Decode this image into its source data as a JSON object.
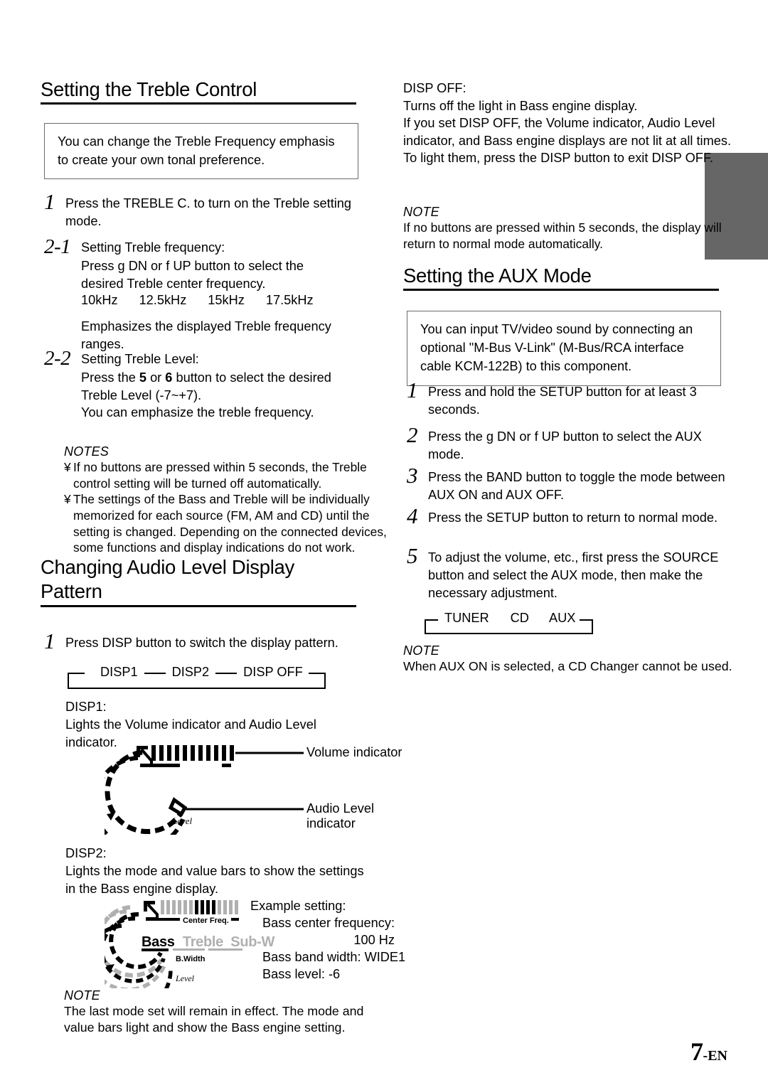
{
  "page": {
    "number": "7",
    "suffix": "-EN"
  },
  "left_column": {
    "treble": {
      "heading": "Setting the Treble Control",
      "intro": "You can change the Treble Frequency emphasis to create your own tonal preference.",
      "step1": {
        "num": "1",
        "text": "Press the TREBLE C. to turn on the Treble setting mode."
      },
      "step2_1": {
        "num": "2-1",
        "title": "Setting  Treble frequency:",
        "line1": "Press g        DN or f        UP button to select the",
        "line2": "desired Treble center frequency.",
        "frequencies": [
          "10kHz",
          "12.5kHz",
          "15kHz",
          "17.5kHz"
        ],
        "after": "Emphasizes the displayed Treble frequency ranges."
      },
      "step2_2": {
        "num": "2-2",
        "title": "Setting Treble Level:",
        "line1_a": "Press the ",
        "line1_b": "5",
        "line1_c": " or ",
        "line1_d": "6",
        "line1_e": " button to select the desired",
        "line2": "Treble Level (-7~+7).",
        "line3": "You can emphasize the treble frequency."
      },
      "notes_heading": "NOTES",
      "notes": [
        {
          "bullet": "¥",
          "text": "If no buttons are pressed within 5 seconds, the Treble control setting will be turned off automatically."
        },
        {
          "bullet": "¥",
          "text": "The settings of the Bass and Treble will be individually memorized for each source (FM, AM and CD) until the setting is changed. Depending on the connected devices, some functions and display indications do not work."
        }
      ]
    },
    "display_pattern": {
      "heading_line1": "Changing Audio Level Display",
      "heading_line2": "Pattern",
      "step1": {
        "num": "1",
        "text": "Press DISP button to switch the display pattern."
      },
      "cycle": [
        "DISP1",
        "DISP2",
        "DISP OFF"
      ],
      "disp1": {
        "label": "DISP1:",
        "text": "Lights the Volume indicator and Audio Level indicator.",
        "callout_volume": "Volume indicator",
        "callout_audio_level": "Audio Level indicator",
        "arc_label_level": "Level"
      },
      "disp2": {
        "label": "DISP2:",
        "text": "Lights the mode and value bars to show the settings in the Bass engine display.",
        "arc_label_center_freq": "Center Freq.",
        "arc_label_bwidth": "B.Width",
        "arc_label_level": "Level",
        "mode_bass": "Bass",
        "mode_treble": "Treble",
        "mode_subw": "Sub-W",
        "example_title": "Example setting:",
        "example_line1": "Bass center frequency:",
        "example_line2": "100 Hz",
        "example_line3": "Bass band width: WIDE1",
        "example_line4": "Bass level: -6"
      },
      "note_heading": "NOTE",
      "note_text": "The last mode set will remain in effect. The mode and value bars light and show the Bass engine setting."
    }
  },
  "right_column": {
    "disp_off": {
      "label": "DISP OFF:",
      "line1": "Turns off the light in Bass engine display.",
      "line2": "If you set DISP OFF, the Volume indicator, Audio Level indicator, and Bass engine displays are not lit at all times.",
      "line3": "To light them, press the DISP button to exit DISP OFF.",
      "note_heading": "NOTE",
      "note_text": "If no buttons are pressed within 5 seconds, the display will return to normal mode automatically."
    },
    "aux": {
      "heading": "Setting the AUX Mode",
      "intro": "You can input TV/video sound by connecting an optional \"M-Bus V-Link\" (M-Bus/RCA interface cable KCM-122B) to this component.",
      "steps": [
        {
          "num": "1",
          "text": "Press and hold the SETUP button for at least 3 seconds."
        },
        {
          "num": "2",
          "text": "Press the g        DN or f        UP button to select the AUX mode."
        },
        {
          "num": "3",
          "text": "Press the BAND button to toggle the mode between AUX ON and AUX OFF."
        },
        {
          "num": "4",
          "text": "Press the SETUP button to return to normal mode."
        },
        {
          "num": "5",
          "text": "To adjust the volume, etc., first press the SOURCE button and select the AUX mode, then make the necessary adjustment."
        }
      ],
      "cycle": [
        "TUNER",
        "CD",
        "AUX"
      ],
      "note_heading": "NOTE",
      "note_text": "When AUX ON is selected, a CD Changer cannot be used."
    }
  },
  "colors": {
    "gray_block": "#666666",
    "box_border": "#6b6b6b",
    "text": "#000000",
    "muted_gray": "#a9a9a9"
  }
}
